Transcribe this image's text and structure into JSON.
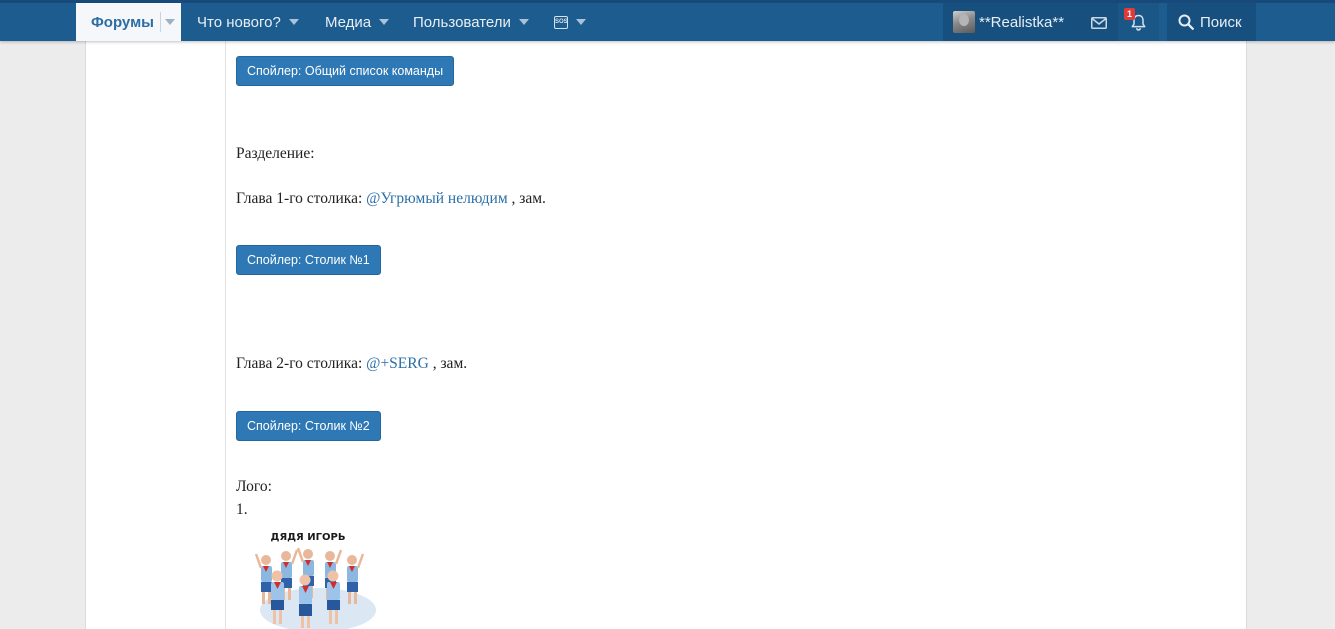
{
  "nav": {
    "tabs": [
      {
        "label": "Форумы",
        "active": true
      },
      {
        "label": "Что нового?"
      },
      {
        "label": "Медиа"
      },
      {
        "label": "Пользователи"
      }
    ],
    "user": {
      "name": "**Realistka**",
      "alerts_count": "1"
    },
    "search_label": "Поиск",
    "extra_icon": "sos-icon"
  },
  "content": {
    "spoiler_team": "Спойлер: Общий список команды",
    "division_label": "Разделение:",
    "table1": {
      "prefix": "Глава 1-го столика: ",
      "mention": "@Угрюмый нелюдим",
      "suffix": " , зам.",
      "spoiler": "Спойлер: Столик №1"
    },
    "table2": {
      "prefix": "Глава 2-го столика: ",
      "mention": "@+SERG",
      "suffix": " , зам.",
      "spoiler": "Спойлер: Столик №2"
    },
    "logo_label": "Лого:",
    "logo_number": "1.",
    "logo_caption": "ДЯДЯ ИГОРЬ"
  },
  "colors": {
    "navbar": "#1d5c8f",
    "accent": "#2d78b5",
    "link": "#2a6fa8",
    "badge": "#e03a3a"
  }
}
